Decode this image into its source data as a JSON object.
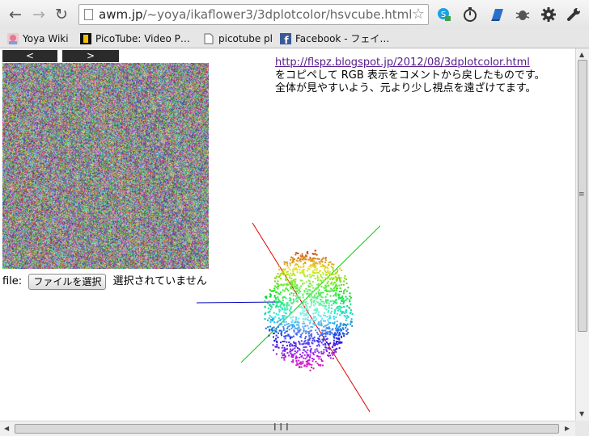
{
  "toolbar": {
    "back_icon": "back-arrow-icon",
    "forward_icon": "forward-arrow-icon",
    "reload_icon": "reload-icon",
    "url_host": "awm.jp",
    "url_path": "/~yoya/ikaflower3/3dplotcolor/hsvcube.html",
    "bookmark_star_icon": "star-icon",
    "extensions": [
      "skype-icon",
      "timer-icon",
      "ruler-icon",
      "bug-icon",
      "gear-icon",
      "wrench-icon"
    ]
  },
  "bookmarks": [
    {
      "label": "Yoya Wiki",
      "icon": "yoya-wiki-icon"
    },
    {
      "label": "PicoTube: Video P…",
      "icon": "picotube-icon"
    },
    {
      "label": "picotube pl",
      "icon": "page-icon"
    },
    {
      "label": "Facebook - フェイ…",
      "icon": "facebook-icon"
    }
  ],
  "page": {
    "prev_label": "<",
    "next_label": ">",
    "file_label": "file:",
    "file_button": "ファイルを選択",
    "file_status": "選択されていません",
    "link_text": "http://flspz.blogspot.jp/2012/08/3dplotcolor.html",
    "desc_line1": "をコピペして RGB 表示をコメントから戻したものです。",
    "desc_line2": "全体が見やすいよう、元より少し視点を遠ざけてます。"
  },
  "plot": {
    "axis_colors": {
      "red": "#e00000",
      "green": "#00cc00",
      "blue": "#0000c0"
    }
  }
}
